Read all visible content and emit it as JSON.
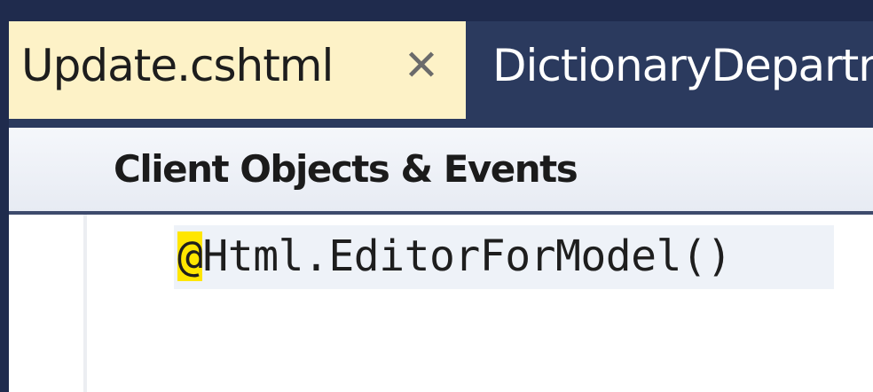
{
  "tabs": [
    {
      "label": "Update.cshtml",
      "active": true,
      "close_glyph": "✕"
    },
    {
      "label": "DictionaryDepartm",
      "active": false
    }
  ],
  "navigation_bar": {
    "label": "Client Objects & Events"
  },
  "editor": {
    "code_line": {
      "razor_prefix": "@",
      "code": "Html.EditorForModel()"
    }
  },
  "colors": {
    "tab_active_bg": "#fdf2c7",
    "tab_strip_bg": "#2b3a5e",
    "razor_highlight": "#ffe600"
  },
  "icons": {
    "tab_close": "close-icon"
  }
}
